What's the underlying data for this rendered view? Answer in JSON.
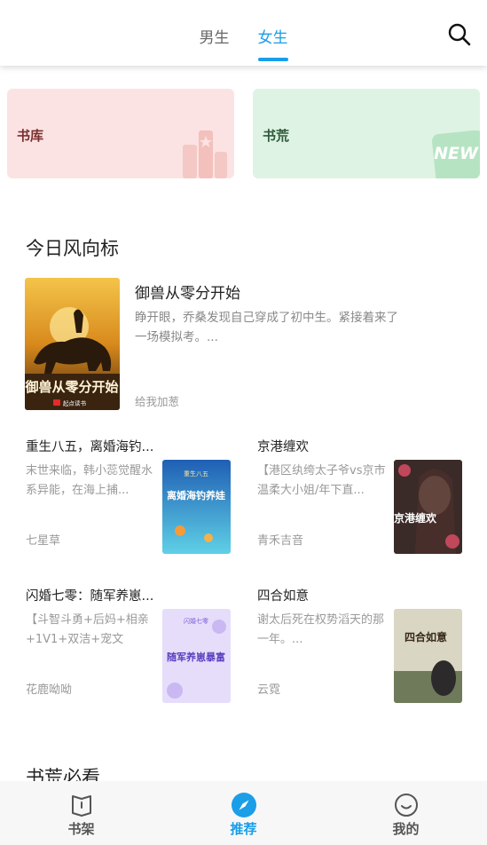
{
  "tabs": [
    {
      "label": "男生",
      "active": false
    },
    {
      "label": "女生",
      "active": true
    }
  ],
  "quick_cards": {
    "library_label": "书库",
    "shortage_label": "书荒",
    "new_badge": "NEW"
  },
  "section_today": "今日风向标",
  "section_must_read": "书荒必看",
  "featured": {
    "title": "御兽从零分开始",
    "description": "睁开眼，乔桑发现自己穿成了初中生。紧接着来了一场模拟考。...",
    "author": "给我加葱",
    "cover_text": "御兽从零分开始",
    "publisher": "起点读书"
  },
  "books": [
    {
      "title": "重生八五，离婚海钓...",
      "description": "末世来临，韩小蕊觉醒水系异能，在海上捕...",
      "author": "七星草",
      "cover_text": "离婚海钓养娃",
      "cover_top": "重生八五"
    },
    {
      "title": "京港缠欢",
      "description": "【港区纨绔太子爷vs京市温柔大小姐/年下直...",
      "author": "青禾吉音",
      "cover_text": "京港缠欢"
    },
    {
      "title": "闪婚七零：随军养崽...",
      "description": "【斗智斗勇+后妈+相亲+1V1+双洁+宠文+爽...",
      "author": "花鹿呦呦",
      "cover_text": "随军养崽暴富",
      "cover_top": "闪婚七零"
    },
    {
      "title": "四合如意",
      "description": "谢太后死在权势滔天的那一年。...",
      "author": "云霓",
      "cover_text": "四合如意"
    }
  ],
  "bottom_nav": [
    {
      "label": "书架",
      "icon": "bookshelf-icon",
      "active": false
    },
    {
      "label": "推荐",
      "icon": "compass-icon",
      "active": true
    },
    {
      "label": "我的",
      "icon": "smile-icon",
      "active": false
    }
  ],
  "colors": {
    "accent": "#1a9ee8",
    "library_card": "#fbe3e3",
    "shortage_card": "#def3e4"
  }
}
